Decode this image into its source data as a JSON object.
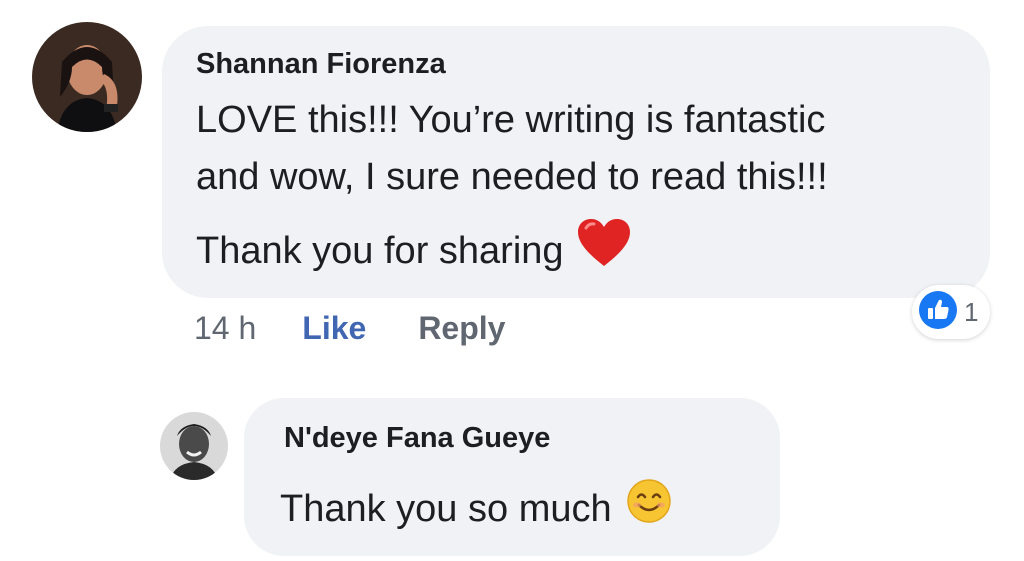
{
  "comments": [
    {
      "author": "Shannan Fiorenza",
      "lines": [
        "LOVE this!!! You’re writing is fantastic",
        "and wow, I sure needed to read this!!!",
        "Thank you for sharing"
      ],
      "emoji": "red-heart-icon",
      "timestamp": "14 h",
      "like_label": "Like",
      "reply_label": "Reply",
      "reaction_count": "1",
      "reaction_icon": "like-thumb-icon"
    },
    {
      "author": "N'deye Fana Gueye",
      "text": "Thank you so much",
      "emoji": "smiling-face-icon"
    }
  ],
  "colors": {
    "bubble": "#f0f2f5",
    "link": "#4267b2",
    "meta": "#606770",
    "like_blue": "#1877f2",
    "heart": "#e02424"
  }
}
